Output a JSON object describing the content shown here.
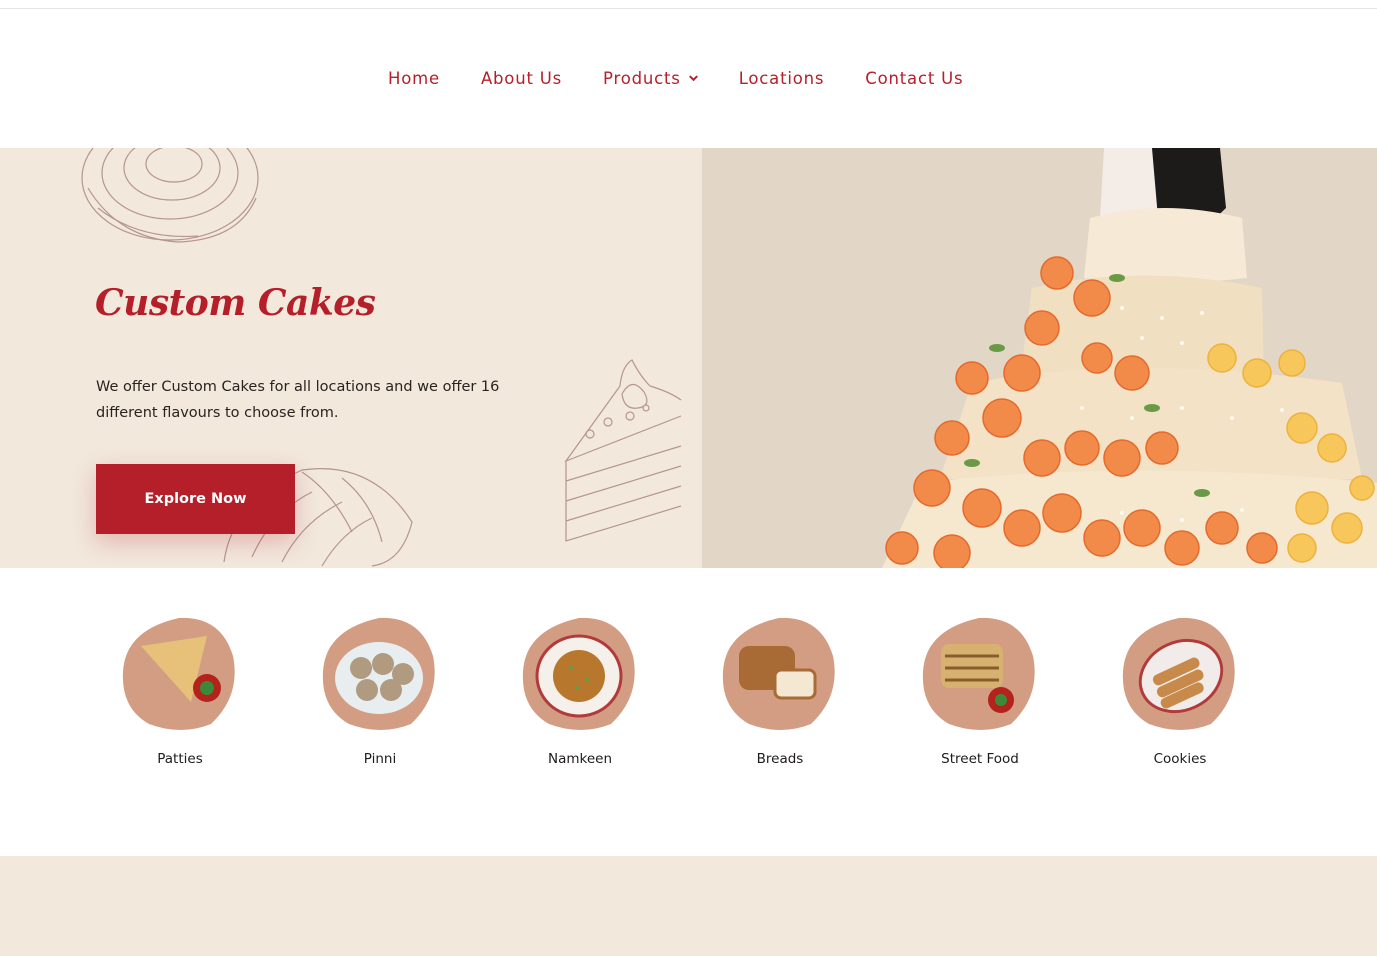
{
  "nav": {
    "items": [
      {
        "label": "Home"
      },
      {
        "label": "About Us"
      },
      {
        "label": "Products",
        "has_dropdown": true
      },
      {
        "label": "Locations"
      },
      {
        "label": "Contact Us"
      }
    ]
  },
  "hero": {
    "title": "Custom Cakes",
    "description": "We offer Custom Cakes for all locations and we offer 16 different flavours to choose from.",
    "button_label": "Explore Now"
  },
  "products": [
    {
      "label": "Patties",
      "icon": "patties-image"
    },
    {
      "label": "Pinni",
      "icon": "pinni-image"
    },
    {
      "label": "Namkeen",
      "icon": "namkeen-image"
    },
    {
      "label": "Breads",
      "icon": "breads-image"
    },
    {
      "label": "Street Food",
      "icon": "street-food-image"
    },
    {
      "label": "Cookies",
      "icon": "cookies-image"
    }
  ],
  "colors": {
    "brand_red": "#b51f2a",
    "cream": "#f2e8dc",
    "brush": "#d29d82"
  }
}
